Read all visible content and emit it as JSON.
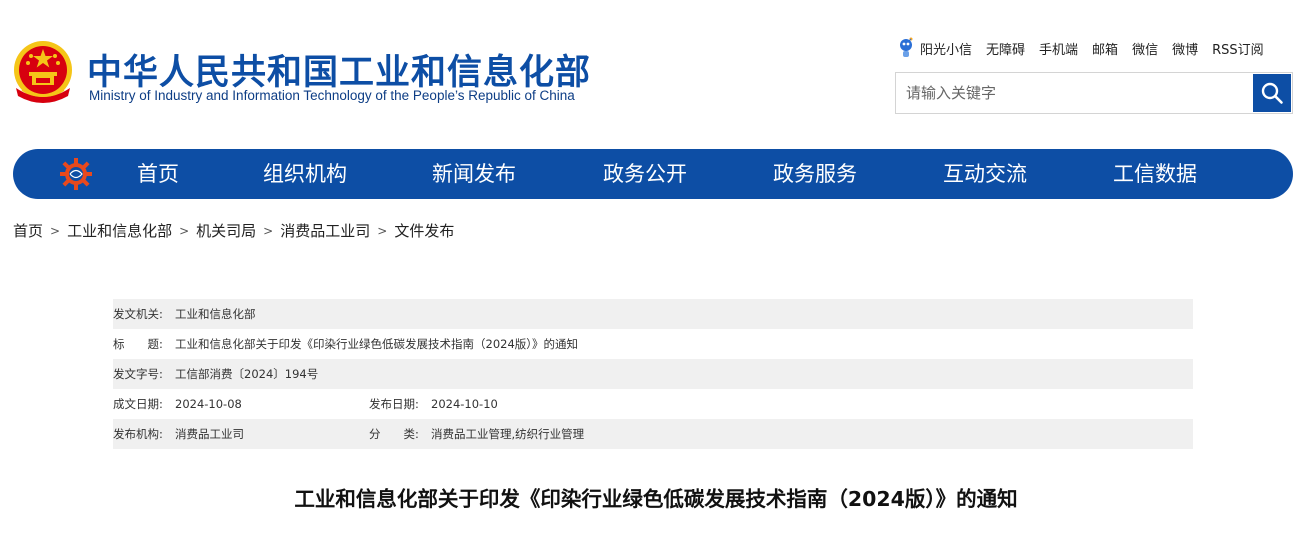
{
  "header": {
    "title": "中华人民共和国工业和信息化部",
    "subtitle": "Ministry of Industry and Information Technology of the People’s Republic of China",
    "emblem_icon": "national-emblem-icon",
    "colors": {
      "brand_blue": "#0d4ea5",
      "emblem_red": "#d7000f",
      "emblem_gold": "#f5c518"
    }
  },
  "toplinks": {
    "robot_icon": "robot-assistant-icon",
    "items": [
      "阳光小信",
      "无障碍",
      "手机端",
      "邮箱",
      "微信",
      "微博",
      "RSS订阅"
    ]
  },
  "search": {
    "placeholder": "请输入关键字",
    "value": "",
    "button_icon": "search-icon"
  },
  "nav": {
    "logo_icon": "gear-globe-logo-icon",
    "items": [
      "首页",
      "组织机构",
      "新闻发布",
      "政务公开",
      "政务服务",
      "互动交流",
      "工信数据"
    ]
  },
  "breadcrumb": {
    "items": [
      "首页",
      "工业和信息化部",
      "机关司局",
      "消费品工业司",
      "文件发布"
    ],
    "separator": ">"
  },
  "meta": {
    "issuer_label": "发文机关:",
    "issuer": "工业和信息化部",
    "title_label": "标　　题:",
    "title": "工业和信息化部关于印发《印染行业绿色低碳发展技术指南（2024版）》的通知",
    "docno_label": "发文字号:",
    "docno": "工信部消费〔2024〕194号",
    "created_label": "成文日期:",
    "created": "2024-10-08",
    "published_label": "发布日期:",
    "published": "2024-10-10",
    "agency_label": "发布机构:",
    "agency": "消费品工业司",
    "category_label": "分　　类:",
    "category": "消费品工业管理,纺织行业管理"
  },
  "document": {
    "title": "工业和信息化部关于印发《印染行业绿色低碳发展技术指南（2024版）》的通知"
  }
}
